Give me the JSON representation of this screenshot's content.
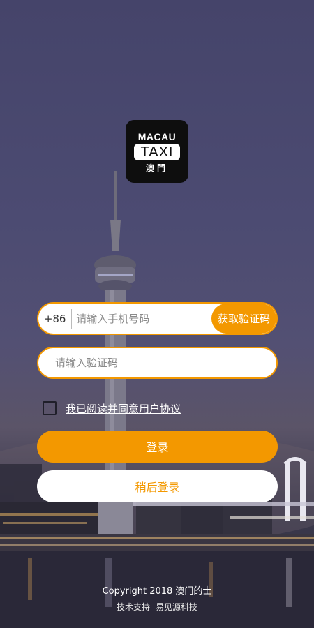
{
  "logo": {
    "line1": "MACAU",
    "line2": "TAXI",
    "line3": "澳門"
  },
  "form": {
    "country_code": "+86",
    "phone_placeholder": "请输入手机号码",
    "get_code_label": "获取验证码",
    "code_placeholder": "请输入验证码",
    "agreement_label": "我已阅读并同意用户协议",
    "agreement_checked": false
  },
  "buttons": {
    "login_label": "登录",
    "later_label": "稍后登录"
  },
  "footer": {
    "copyright": "Copyright 2018 澳门的士",
    "support_label": "技术支持",
    "support_company": "易见源科技"
  },
  "colors": {
    "accent": "#f39800",
    "background": "#4b4a6e"
  }
}
